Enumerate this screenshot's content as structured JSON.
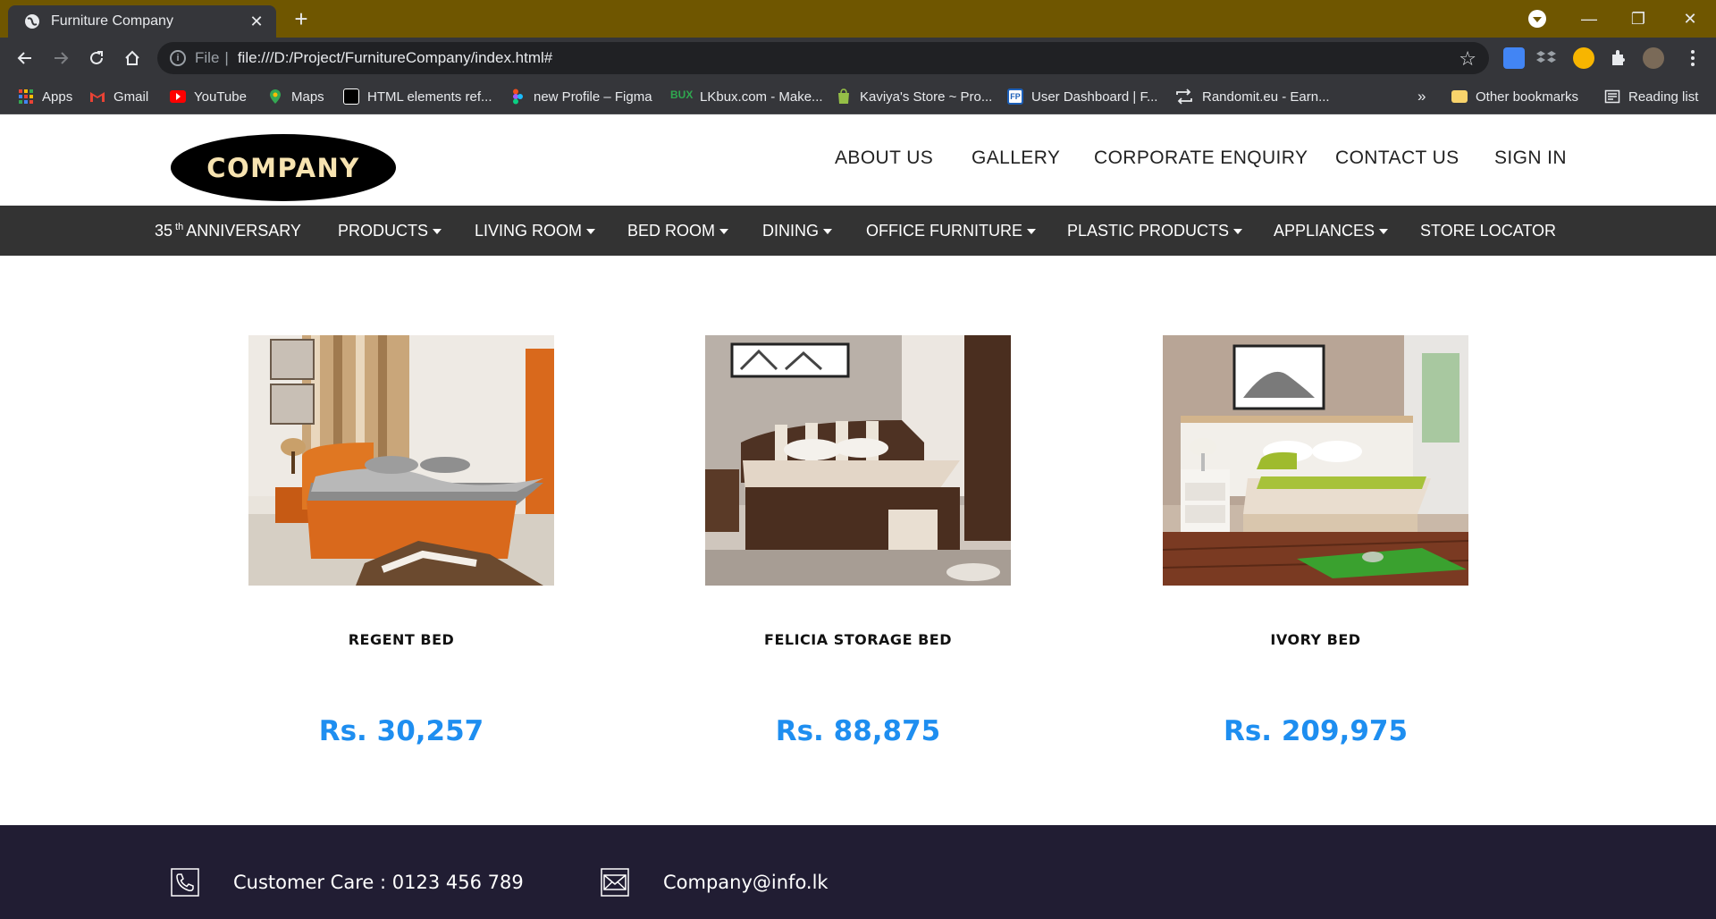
{
  "browser": {
    "tab_title": "Furniture Company",
    "url_scheme": "File",
    "url": "file:///D:/Project/FurnitureCompany/index.html#",
    "bookmarks": [
      {
        "label": "Apps",
        "icon": "apps-grid-icon",
        "color": "#ea4335"
      },
      {
        "label": "Gmail",
        "icon": "gmail-icon",
        "color": "#ea4335"
      },
      {
        "label": "YouTube",
        "icon": "youtube-icon",
        "color": "#ff0000"
      },
      {
        "label": "Maps",
        "icon": "maps-icon",
        "color": "#34a853"
      },
      {
        "label": "HTML elements ref...",
        "icon": "mdn-icon",
        "color": "#ffffff"
      },
      {
        "label": "new Profile – Figma",
        "icon": "figma-icon",
        "color": "#f24e1e"
      },
      {
        "label": "LKbux.com - Make...",
        "icon": "lkbux-icon",
        "color": "#2fa84f"
      },
      {
        "label": "Kaviya's Store ~ Pro...",
        "icon": "shopify-icon",
        "color": "#95bf47"
      },
      {
        "label": "User Dashboard | F...",
        "icon": "fp-icon",
        "color": "#1c5fb8"
      },
      {
        "label": "Randomit.eu - Earn...",
        "icon": "randomit-icon",
        "color": "#e8eaed"
      }
    ],
    "bookmarks_overflow": "»",
    "other_bookmarks": "Other bookmarks",
    "reading_list": "Reading list"
  },
  "site": {
    "logo_text": "COMPANY",
    "top_nav": [
      "ABOUT US",
      "GALLERY",
      "CORPORATE ENQUIRY",
      "CONTACT US",
      "SIGN IN"
    ],
    "categories": {
      "anniversary_number": "35",
      "anniversary_sup": "th",
      "anniversary_label": "ANNIVERSARY",
      "items": [
        "PRODUCTS",
        "LIVING ROOM",
        "BED ROOM",
        "DINING",
        "OFFICE FURNITURE",
        "PLASTIC PRODUCTS",
        "APPLIANCES"
      ],
      "store_locator": "STORE LOCATOR"
    },
    "products": [
      {
        "name": "REGENT BED",
        "price": "Rs. 30,257"
      },
      {
        "name": "FELICIA STORAGE BED",
        "price": "Rs. 88,875"
      },
      {
        "name": "IVORY BED",
        "price": "Rs. 209,975"
      }
    ],
    "footer": {
      "customer_care": "Customer Care : 0123 456 789",
      "email": "Company@info.lk"
    }
  },
  "colors": {
    "price": "#1e8ef0",
    "category_bar": "#333333",
    "footer": "#211d33",
    "tabstrip": "#6f5600"
  }
}
